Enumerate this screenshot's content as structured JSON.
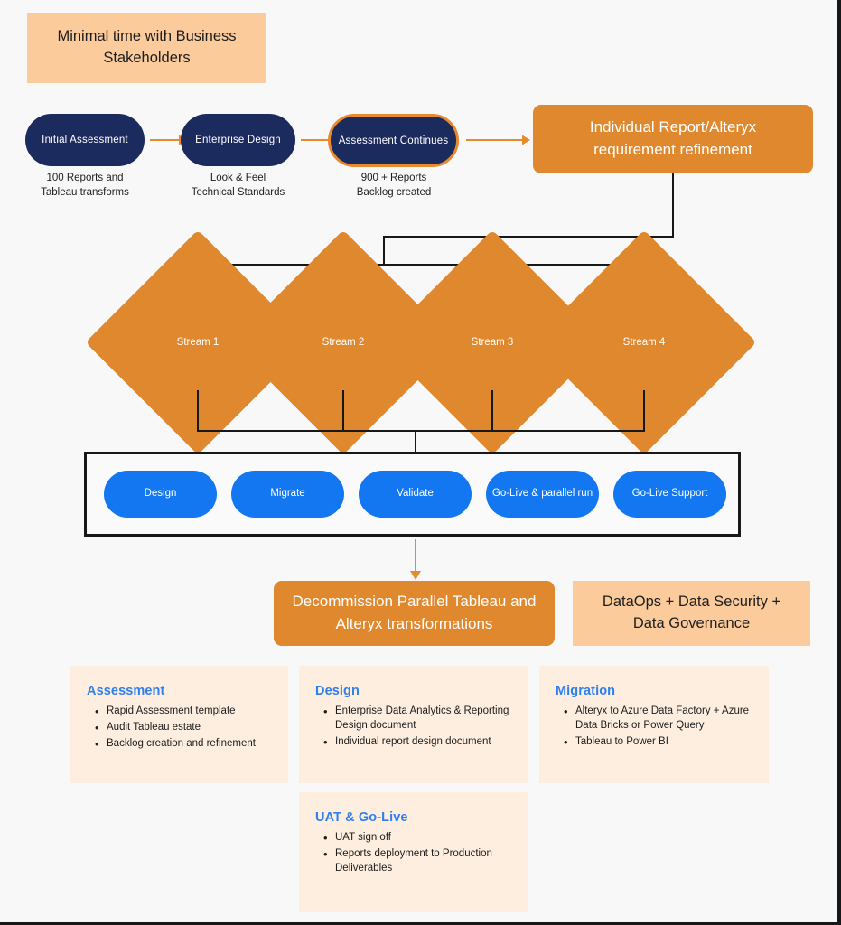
{
  "banner": {
    "text": "Minimal time with Business Stakeholders"
  },
  "flow": {
    "stages": [
      {
        "label": "Initial Assessment",
        "caption": "100 Reports and\nTableau transforms",
        "highlighted": false
      },
      {
        "label": "Enterprise Design",
        "caption": "Look & Feel\nTechnical Standards",
        "highlighted": false
      },
      {
        "label": "Assessment Continues",
        "caption": "900 + Reports\nBacklog created",
        "highlighted": true
      }
    ],
    "refinement_box": "Individual Report/Alteryx requirement refinement"
  },
  "streams": [
    {
      "label": "Stream 1"
    },
    {
      "label": "Stream 2"
    },
    {
      "label": "Stream 3"
    },
    {
      "label": "Stream 4"
    }
  ],
  "phases": [
    {
      "label": "Design"
    },
    {
      "label": "Migrate"
    },
    {
      "label": "Validate"
    },
    {
      "label": "Go-Live & parallel run"
    },
    {
      "label": "Go-Live Support"
    }
  ],
  "outcomes": {
    "decommission": "Decommission Parallel Tableau and Alteryx transformations",
    "dataops": "DataOps + Data Security + Data Governance"
  },
  "cards": [
    {
      "title": "Assessment",
      "items": [
        "Rapid Assessment template",
        "Audit Tableau estate",
        "Backlog creation and refinement"
      ]
    },
    {
      "title": "Design",
      "items": [
        "Enterprise Data Analytics & Reporting Design document",
        " Individual report design document"
      ]
    },
    {
      "title": "Migration",
      "items": [
        "Alteryx to Azure Data Factory + Azure Data Bricks or Power Query",
        "Tableau to Power BI"
      ]
    },
    {
      "title": "UAT & Go-Live",
      "items": [
        "UAT sign off",
        "Reports deployment to Production Deliverables"
      ]
    }
  ],
  "colors": {
    "navy": "#1c2b5e",
    "orange": "#e0882e",
    "peach": "#fbcb9b",
    "card_bg": "#fdeee0",
    "blue": "#1277f0",
    "accent_blue": "#2f80ed",
    "line": "#17181a",
    "background": "#f8f8f8"
  }
}
